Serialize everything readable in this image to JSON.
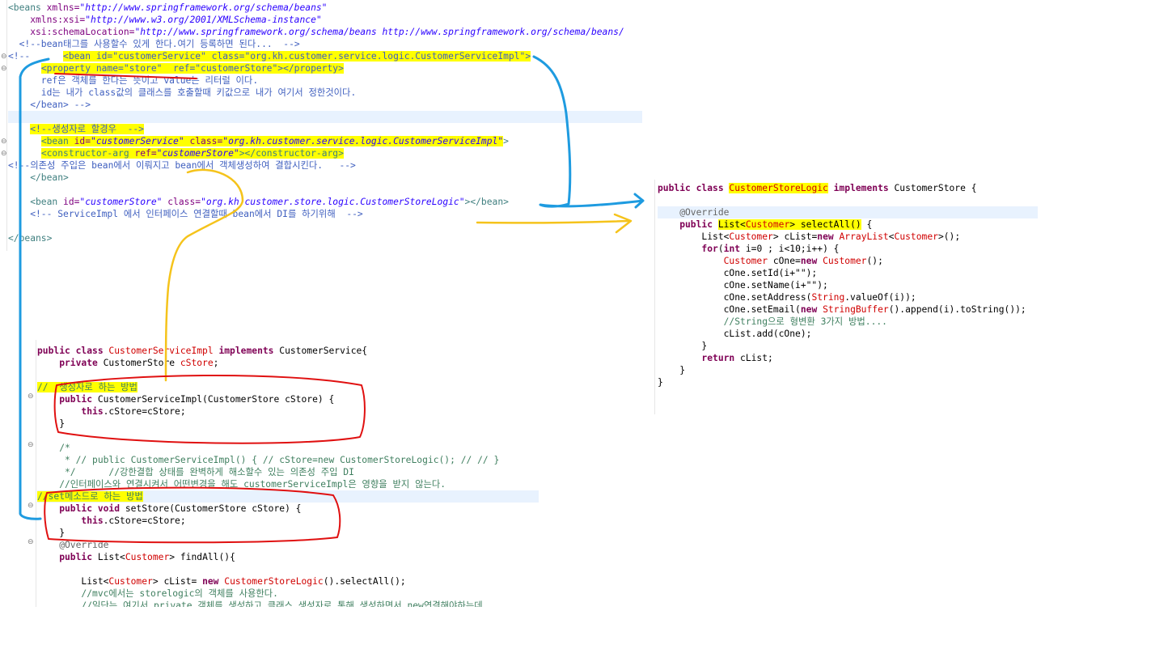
{
  "xml": {
    "lines": [
      {
        "segs": [
          [
            "<beans ",
            "xt"
          ],
          [
            "xmlns=",
            "xa"
          ],
          [
            "\"http://www.springframework.org/schema/beans\"",
            "xs"
          ]
        ]
      },
      {
        "segs": [
          [
            "    xmlns:xsi=",
            "xa"
          ],
          [
            "\"http://www.w3.org/2001/XMLSchema-instance\"",
            "xs"
          ]
        ]
      },
      {
        "segs": [
          [
            "    xsi:schemaLocation=",
            "xa"
          ],
          [
            "\"http://www.springframework.org/schema/beans http://www.springframework.org/schema/beans/",
            "xs"
          ]
        ]
      },
      {
        "segs": [
          [
            "  <!--bean태그를 사용할수 있게 한다.여기 등록하면 된다...  -->",
            "xc"
          ]
        ]
      },
      {
        "segs": [
          [
            "<!--      ",
            "xc"
          ],
          [
            "<bean id=\"customerService\" class=\"org.kh.customer.service.logic.CustomerServiceImpl\">",
            "xc hl"
          ]
        ]
      },
      {
        "segs": [
          [
            "      ",
            "xc"
          ],
          [
            "<property name=\"store\"  ref=\"customerStore\"></property>",
            "xc hl"
          ]
        ]
      },
      {
        "segs": [
          [
            "      ref은 객체를 한다는 뜻이고 value는 리터럴 이다.",
            "xc"
          ]
        ]
      },
      {
        "segs": [
          [
            "      id는 내가 class값의 클래스를 호출할때 키값으로 내가 여기서 정한것이다.",
            "xc"
          ]
        ]
      },
      {
        "segs": [
          [
            "    </bean> -->",
            "xc"
          ]
        ]
      },
      {
        "segs": [
          [
            "",
            ""
          ]
        ],
        "cur": true
      },
      {
        "segs": [
          [
            "    ",
            ""
          ],
          [
            "<!--생성자로 할경우  -->",
            "xc hl"
          ]
        ]
      },
      {
        "segs": [
          [
            "      ",
            ""
          ],
          [
            "<bean ",
            "xt hl"
          ],
          [
            "id=",
            "xa hl"
          ],
          [
            "\"customerService\"",
            "xs hl"
          ],
          [
            " class=",
            "xa hl"
          ],
          [
            "\"org.kh.customer.service.logic.CustomerServiceImpl\"",
            "xs hl"
          ],
          [
            ">",
            "xt"
          ]
        ]
      },
      {
        "segs": [
          [
            "      ",
            ""
          ],
          [
            "<constructor-arg ",
            "xt hl"
          ],
          [
            "ref=",
            "xa hl"
          ],
          [
            "\"customerStore\"",
            "xs hl"
          ],
          [
            "></constructor-arg>",
            "xt hl"
          ]
        ]
      },
      {
        "segs": [
          [
            "<!--의존성 주입은 bean에서 이뤄지고 bean에서 객체생성하여 결합시킨다.   -->",
            "xc"
          ]
        ]
      },
      {
        "segs": [
          [
            "    </bean>",
            "xt"
          ]
        ]
      },
      {
        "segs": [
          [
            "",
            ""
          ]
        ]
      },
      {
        "segs": [
          [
            "    <bean ",
            "xt"
          ],
          [
            "id=",
            "xa"
          ],
          [
            "\"customerStore\"",
            "xs"
          ],
          [
            " class=",
            "xa"
          ],
          [
            "\"org.kh.customer.store.logic.CustomerStoreLogic\"",
            "xs"
          ],
          [
            "></bean>",
            "xt"
          ]
        ]
      },
      {
        "segs": [
          [
            "    <!-- ServiceImpl 에서 인터페이스 연결할때 bean에서 DI를 하기위해  -->",
            "xc"
          ]
        ]
      },
      {
        "segs": [
          [
            "",
            ""
          ]
        ]
      },
      {
        "segs": [
          [
            "</beans>",
            "xt"
          ]
        ]
      }
    ]
  },
  "service": {
    "lines": [
      {
        "segs": [
          [
            "public class ",
            "k"
          ],
          [
            "CustomerServiceImpl",
            "t"
          ],
          [
            " implements ",
            "k"
          ],
          [
            "CustomerService{",
            ""
          ]
        ]
      },
      {
        "segs": [
          [
            "    private ",
            "k"
          ],
          [
            "CustomerStore ",
            ""
          ],
          [
            "cStore",
            "t"
          ],
          [
            ";",
            ""
          ]
        ]
      },
      {
        "segs": [
          [
            "",
            ""
          ]
        ]
      },
      {
        "segs": [
          [
            "//  생성자로 하는 방법",
            "c hl"
          ]
        ]
      },
      {
        "segs": [
          [
            "    public ",
            "k"
          ],
          [
            "CustomerServiceImpl(CustomerStore cStore) {",
            ""
          ]
        ]
      },
      {
        "segs": [
          [
            "        this",
            "k"
          ],
          [
            ".cStore=cStore;",
            ""
          ]
        ]
      },
      {
        "segs": [
          [
            "    }",
            ""
          ]
        ]
      },
      {
        "segs": [
          [
            "",
            ""
          ]
        ]
      },
      {
        "segs": [
          [
            "    /*",
            "c"
          ]
        ]
      },
      {
        "segs": [
          [
            "     * // public CustomerServiceImpl() { // cStore=new CustomerStoreLogic(); // // }",
            "c"
          ]
        ]
      },
      {
        "segs": [
          [
            "     */      //강한결합 상태를 완벽하게 해소할수 있는 의존성 주입 DI",
            "c"
          ]
        ]
      },
      {
        "segs": [
          [
            "    //인터페이스와 연결시켜서 어떤변경을 해도 customerServiceImpl은 영향을 받지 않는다.",
            "c"
          ]
        ]
      },
      {
        "segs": [
          [
            "//set메소드로 하는 방법",
            "c hl"
          ],
          [
            " ",
            ""
          ]
        ],
        "cur": true
      },
      {
        "segs": [
          [
            "    public void ",
            "k"
          ],
          [
            "setStore(CustomerStore cStore) {",
            ""
          ]
        ]
      },
      {
        "segs": [
          [
            "        this",
            "k"
          ],
          [
            ".cStore=cStore;",
            ""
          ]
        ]
      },
      {
        "segs": [
          [
            "    }",
            ""
          ]
        ]
      },
      {
        "segs": [
          [
            "    @Override",
            "ann"
          ]
        ]
      },
      {
        "segs": [
          [
            "    public ",
            "k"
          ],
          [
            "List<",
            ""
          ],
          [
            "Customer",
            "t"
          ],
          [
            "> findAll(){",
            ""
          ]
        ]
      },
      {
        "segs": [
          [
            "",
            ""
          ]
        ]
      },
      {
        "segs": [
          [
            "        List<",
            ""
          ],
          [
            "Customer",
            "t"
          ],
          [
            "> cList= ",
            ""
          ],
          [
            "new ",
            "k"
          ],
          [
            "CustomerStoreLogic",
            "t"
          ],
          [
            "().selectAll();",
            ""
          ]
        ]
      },
      {
        "segs": [
          [
            "        //mvc에서는 storelogic의 객체를 사용한다.",
            "c"
          ]
        ]
      },
      {
        "segs": [
          [
            "        //일단는 여기서 private 객체를 생성하고 클래스 생성자로 통해 생성하면서 new연결해야하는데",
            "c"
          ]
        ]
      }
    ]
  },
  "store": {
    "lines": [
      {
        "segs": [
          [
            "public class ",
            "k"
          ],
          [
            "CustomerStoreLogic",
            "t hl"
          ],
          [
            " implements ",
            "k"
          ],
          [
            "CustomerStore {",
            ""
          ]
        ]
      },
      {
        "segs": [
          [
            "",
            ""
          ]
        ]
      },
      {
        "segs": [
          [
            "    @Override",
            "ann"
          ]
        ],
        "cur": true
      },
      {
        "segs": [
          [
            "    public ",
            "k"
          ],
          [
            "List<",
            "hl"
          ],
          [
            "Customer",
            "t hl"
          ],
          [
            "> selectAll()",
            "hl"
          ],
          [
            " {",
            ""
          ]
        ]
      },
      {
        "segs": [
          [
            "        List<",
            ""
          ],
          [
            "Customer",
            "t"
          ],
          [
            "> cList=",
            ""
          ],
          [
            "new ",
            "k"
          ],
          [
            "ArrayList",
            "t"
          ],
          [
            "<",
            ""
          ],
          [
            "Customer",
            "t"
          ],
          [
            ">();",
            ""
          ]
        ]
      },
      {
        "segs": [
          [
            "        for",
            "k"
          ],
          [
            "(",
            ""
          ],
          [
            "int ",
            "k"
          ],
          [
            "i=0 ; i<10;i++) {",
            ""
          ]
        ]
      },
      {
        "segs": [
          [
            "            Customer ",
            "t"
          ],
          [
            "cOne=",
            ""
          ],
          [
            "new ",
            "k"
          ],
          [
            "Customer",
            "t"
          ],
          [
            "();",
            ""
          ]
        ]
      },
      {
        "segs": [
          [
            "            cOne.setId(i+\"\");",
            ""
          ]
        ]
      },
      {
        "segs": [
          [
            "            cOne.setName(i+\"\");",
            ""
          ]
        ]
      },
      {
        "segs": [
          [
            "            cOne.setAddress(",
            ""
          ],
          [
            "String",
            "t"
          ],
          [
            ".valueOf(i));",
            ""
          ]
        ]
      },
      {
        "segs": [
          [
            "            cOne.setEmail(",
            ""
          ],
          [
            "new ",
            "k"
          ],
          [
            "StringBuffer",
            "t"
          ],
          [
            "().append(i).toString());",
            ""
          ]
        ]
      },
      {
        "segs": [
          [
            "            //String으로 형변환 3가지 방법....",
            "c"
          ]
        ]
      },
      {
        "segs": [
          [
            "            cList.add(cOne);",
            ""
          ]
        ]
      },
      {
        "segs": [
          [
            "        }",
            ""
          ]
        ]
      },
      {
        "segs": [
          [
            "        return ",
            "k"
          ],
          [
            "cList;",
            ""
          ]
        ]
      },
      {
        "segs": [
          [
            "    }",
            ""
          ]
        ]
      },
      {
        "segs": [
          [
            "}",
            ""
          ]
        ]
      }
    ]
  },
  "folds": [
    "⊖",
    "⊖",
    "⊖",
    "⊖",
    "⊖",
    "⊖",
    "⊖",
    "⊖"
  ],
  "colors": {
    "annotation_yellow": "#ffff00",
    "arrow_blue": "#1e9be0",
    "arrow_orange": "#f5c31b",
    "box_red": "#e01010",
    "underline_red": "#e01010"
  }
}
